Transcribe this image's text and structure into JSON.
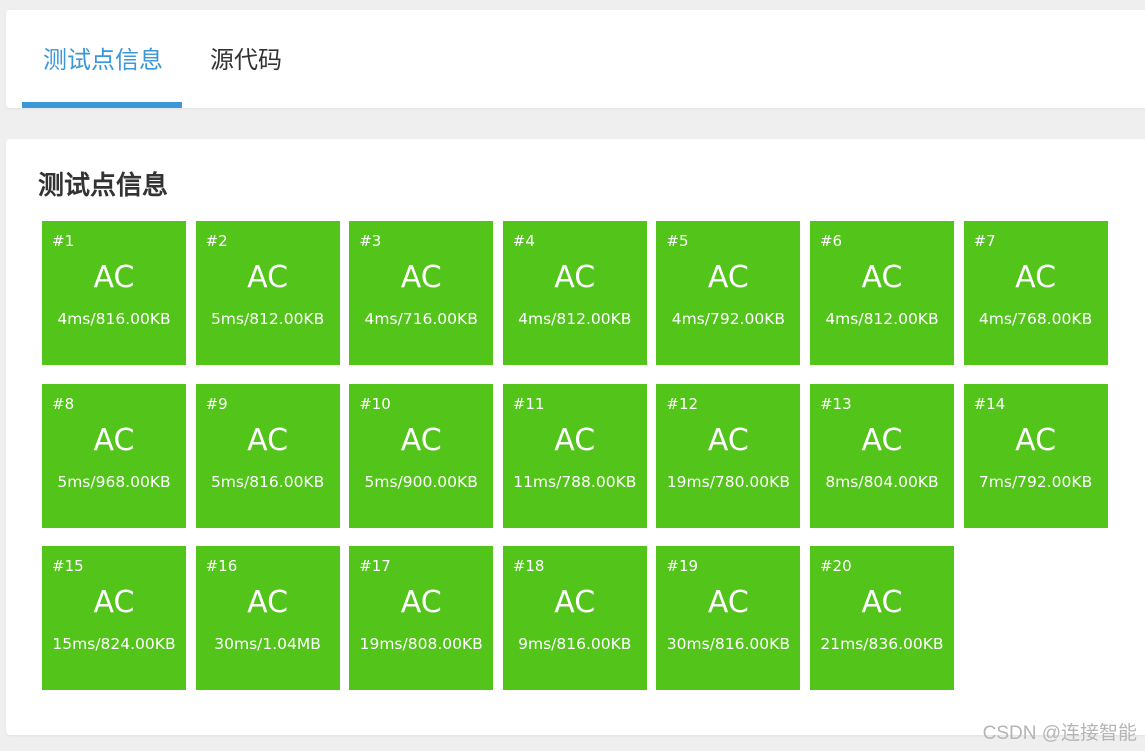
{
  "tabs": [
    {
      "label": "测试点信息",
      "active": true
    },
    {
      "label": "源代码",
      "active": false
    }
  ],
  "section_title": "测试点信息",
  "accent_color": "#3a97d8",
  "status_color": "#52c41a",
  "testcases": [
    {
      "id": "#1",
      "status": "AC",
      "info": "4ms/816.00KB"
    },
    {
      "id": "#2",
      "status": "AC",
      "info": "5ms/812.00KB"
    },
    {
      "id": "#3",
      "status": "AC",
      "info": "4ms/716.00KB"
    },
    {
      "id": "#4",
      "status": "AC",
      "info": "4ms/812.00KB"
    },
    {
      "id": "#5",
      "status": "AC",
      "info": "4ms/792.00KB"
    },
    {
      "id": "#6",
      "status": "AC",
      "info": "4ms/812.00KB"
    },
    {
      "id": "#7",
      "status": "AC",
      "info": "4ms/768.00KB"
    },
    {
      "id": "#8",
      "status": "AC",
      "info": "5ms/968.00KB"
    },
    {
      "id": "#9",
      "status": "AC",
      "info": "5ms/816.00KB"
    },
    {
      "id": "#10",
      "status": "AC",
      "info": "5ms/900.00KB"
    },
    {
      "id": "#11",
      "status": "AC",
      "info": "11ms/788.00KB"
    },
    {
      "id": "#12",
      "status": "AC",
      "info": "19ms/780.00KB"
    },
    {
      "id": "#13",
      "status": "AC",
      "info": "8ms/804.00KB"
    },
    {
      "id": "#14",
      "status": "AC",
      "info": "7ms/792.00KB"
    },
    {
      "id": "#15",
      "status": "AC",
      "info": "15ms/824.00KB"
    },
    {
      "id": "#16",
      "status": "AC",
      "info": "30ms/1.04MB"
    },
    {
      "id": "#17",
      "status": "AC",
      "info": "19ms/808.00KB"
    },
    {
      "id": "#18",
      "status": "AC",
      "info": "9ms/816.00KB"
    },
    {
      "id": "#19",
      "status": "AC",
      "info": "30ms/816.00KB"
    },
    {
      "id": "#20",
      "status": "AC",
      "info": "21ms/836.00KB"
    }
  ],
  "watermark": "CSDN @连接智能"
}
